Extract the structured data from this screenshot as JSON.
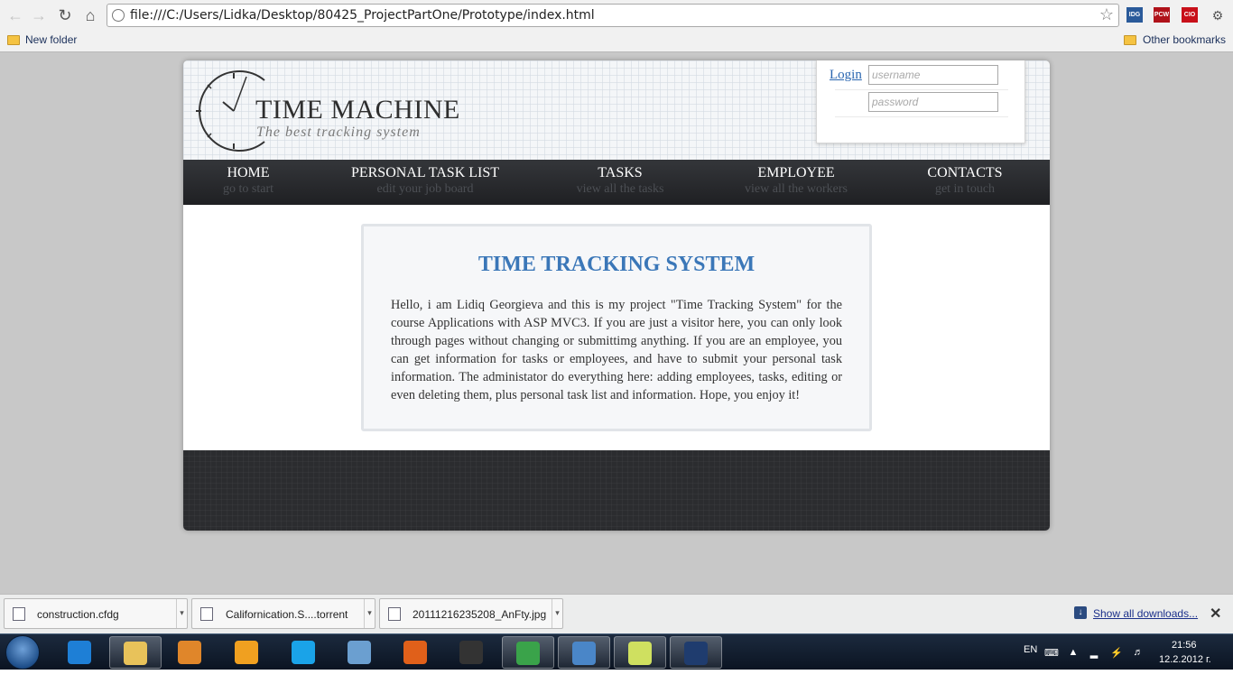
{
  "browser": {
    "url": "file:///C:/Users/Lidka/Desktop/80425_ProjectPartOne/Prototype/index.html",
    "extensions": [
      {
        "label": "IDG",
        "color": "#2a5a9a"
      },
      {
        "label": "PCW",
        "color": "#b0121a"
      },
      {
        "label": "CIO",
        "color": "#c8101a"
      }
    ],
    "bookmarks": {
      "left": "New folder",
      "right": "Other bookmarks"
    }
  },
  "site": {
    "title": "TIME MACHINE",
    "tagline": "The best tracking system",
    "login": {
      "link": "Login",
      "username_placeholder": "username",
      "password_placeholder": "password"
    },
    "menu": [
      {
        "title": "HOME",
        "sub": "go to start"
      },
      {
        "title": "PERSONAL TASK LIST",
        "sub": "edit your job board"
      },
      {
        "title": "TASKS",
        "sub": "view all the tasks"
      },
      {
        "title": "EMPLOYEE",
        "sub": "view all the workers"
      },
      {
        "title": "CONTACTS",
        "sub": "get in touch"
      }
    ],
    "panel": {
      "title": "TIME TRACKING SYSTEM",
      "text": "Hello, i am Lidiq Georgieva and this is my project \"Time Tracking System\" for the course Applications with ASP MVC3. If you are just a visitor here, you can only look through pages without changing or submittimg anything. If you are an employee, you can get information for tasks or employees, and have to submit your personal task information. The administator do everything here: adding employees, tasks, editing or even deleting them, plus personal task list and information. Hope, you enjoy it!"
    }
  },
  "downloads": {
    "items": [
      "construction.cfdg",
      "Californication.S....torrent",
      "20111216235208_AnFty.jpg"
    ],
    "show_all": "Show all downloads..."
  },
  "taskbar": {
    "apps": [
      {
        "name": "internet-explorer",
        "color": "#1e7fd6"
      },
      {
        "name": "file-explorer",
        "color": "#e8c25a"
      },
      {
        "name": "media-player",
        "color": "#e0862a"
      },
      {
        "name": "winamp",
        "color": "#f0a020"
      },
      {
        "name": "skype",
        "color": "#1aa3e8"
      },
      {
        "name": "safari",
        "color": "#6b9fd0"
      },
      {
        "name": "firefox",
        "color": "#e0601a"
      },
      {
        "name": "321-player",
        "color": "#333333"
      },
      {
        "name": "chrome",
        "color": "#3aa34a"
      },
      {
        "name": "photo-viewer",
        "color": "#4a86c8"
      },
      {
        "name": "chart-app",
        "color": "#cfe060"
      },
      {
        "name": "photoshop",
        "color": "#1f3c6e"
      }
    ],
    "language": "EN",
    "time": "21:56",
    "date": "12.2.2012 г."
  }
}
